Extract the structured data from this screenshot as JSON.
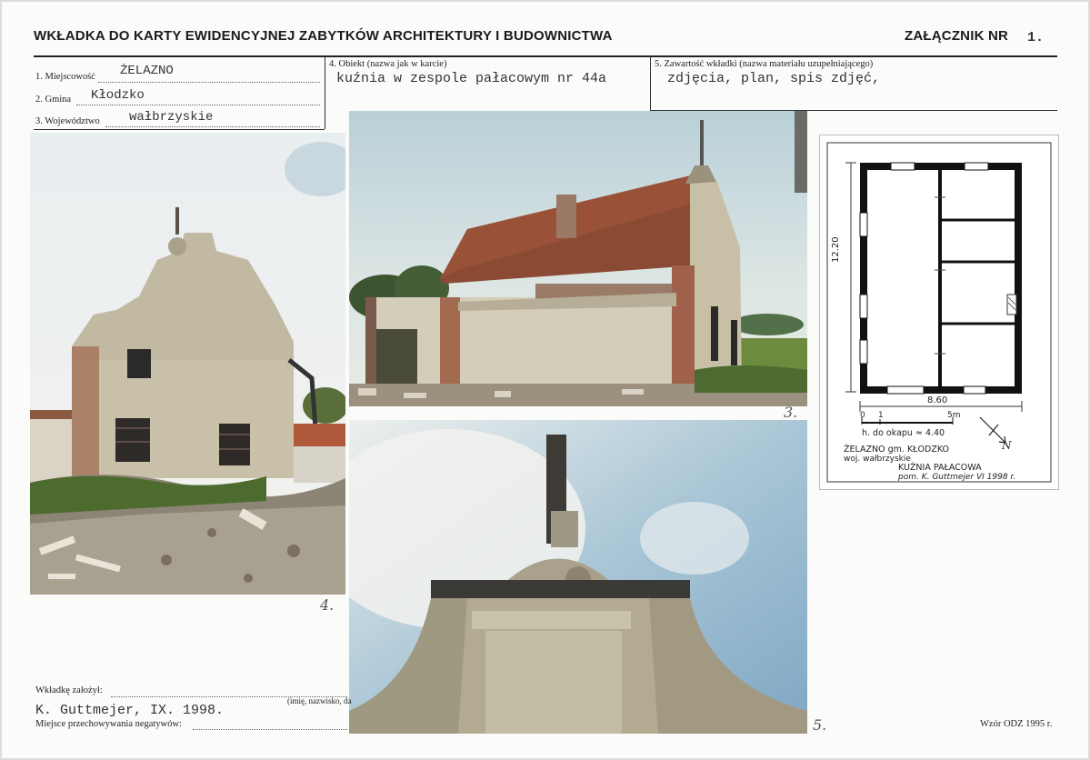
{
  "header": {
    "title": "WKŁADKA DO KARTY EWIDENCYJNEJ ZABYTKÓW ARCHITEKTURY I BUDOWNICTWA",
    "annex_label": "ZAŁĄCZNIK NR",
    "annex_number": "1."
  },
  "fields": {
    "miejscowosc_label": "1. Miejscowość",
    "miejscowosc_value": "ŻELAZNO",
    "gmina_label": "2. Gmina",
    "gmina_value": "Kłodzko",
    "wojewodztwo_label": "3. Województwo",
    "wojewodztwo_value": "wałbrzyskie",
    "obiekt_label": "4. Obiekt (nazwa jak w karcie)",
    "obiekt_value": "kuźnia w zespole pałacowym nr 44a",
    "zawartosc_label": "5. Zawartość wkładki (nazwa materiału uzupełniającego)",
    "zawartosc_value": "zdjęcia, plan, spis zdjęć,"
  },
  "photo_numbers": {
    "photo_3": "3.",
    "photo_4": "4.",
    "photo_5": "5."
  },
  "plan": {
    "dim_vertical": "12.20",
    "dim_horizontal": "8.60",
    "scale_0": "0",
    "scale_1": "1",
    "scale_5": "5m",
    "eaves_height": "h. do okapu ≈ 4.40",
    "caption_line1": "ŻELAZNO gm. KŁODZKO",
    "caption_line2": "woj. wałbrzyskie",
    "caption_line3": "KUŹNIA PAŁACOWA",
    "caption_line4": "pom. K. Guttmejer VI 1998 r.",
    "north_label": "N"
  },
  "footer": {
    "founded_label": "Wkładkę założył:",
    "founded_value": "K. Guttmejer, IX. 1998.",
    "name_hint": "(imię, nazwisko, da",
    "negatives_label": "Miejsce przechowywania negatywów:",
    "form_code": "Wzór ODZ 1995 r."
  }
}
